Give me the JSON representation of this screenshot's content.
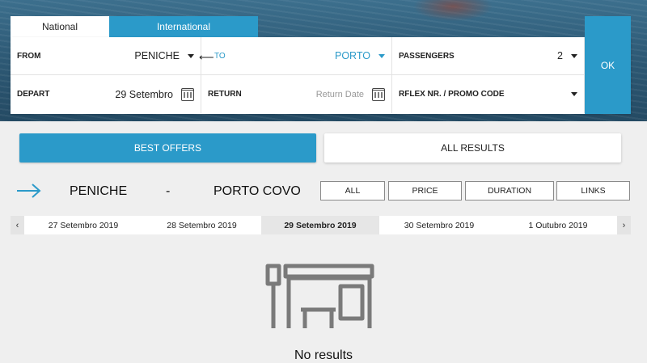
{
  "tabs": {
    "national": "National",
    "international": "International"
  },
  "search": {
    "from_label": "FROM",
    "from_value": "PENICHE",
    "swap_icon": "arrow-left",
    "to_label": "TO",
    "to_value": "PORTO",
    "passengers_label": "PASSENGERS",
    "passengers_value": "2",
    "depart_label": "DEPART",
    "depart_value": "29 Setembro",
    "return_label": "RETURN",
    "return_placeholder": "Return Date",
    "promo_label": "RFLEX NR. / PROMO CODE",
    "ok_label": "OK"
  },
  "results_tabs": {
    "best_offers": "BEST OFFERS",
    "all_results": "ALL RESULTS"
  },
  "route": {
    "origin": "PENICHE",
    "separator": "-",
    "destination": "PORTO COVO"
  },
  "sort_buttons": {
    "all": "ALL",
    "price": "PRICE",
    "duration": "DURATION",
    "links": "LINKS"
  },
  "dates": {
    "prev_icon": "chevron-left",
    "next_icon": "chevron-right",
    "items": [
      "27 Setembro 2019",
      "28 Setembro 2019",
      "29 Setembro 2019",
      "30 Setembro 2019",
      "1 Outubro 2019"
    ],
    "selected": "29 Setembro 2019"
  },
  "empty_state": {
    "icon": "bus-stop-icon",
    "message": "No results"
  },
  "colors": {
    "accent": "#2b9ac9",
    "background": "#efefef"
  }
}
